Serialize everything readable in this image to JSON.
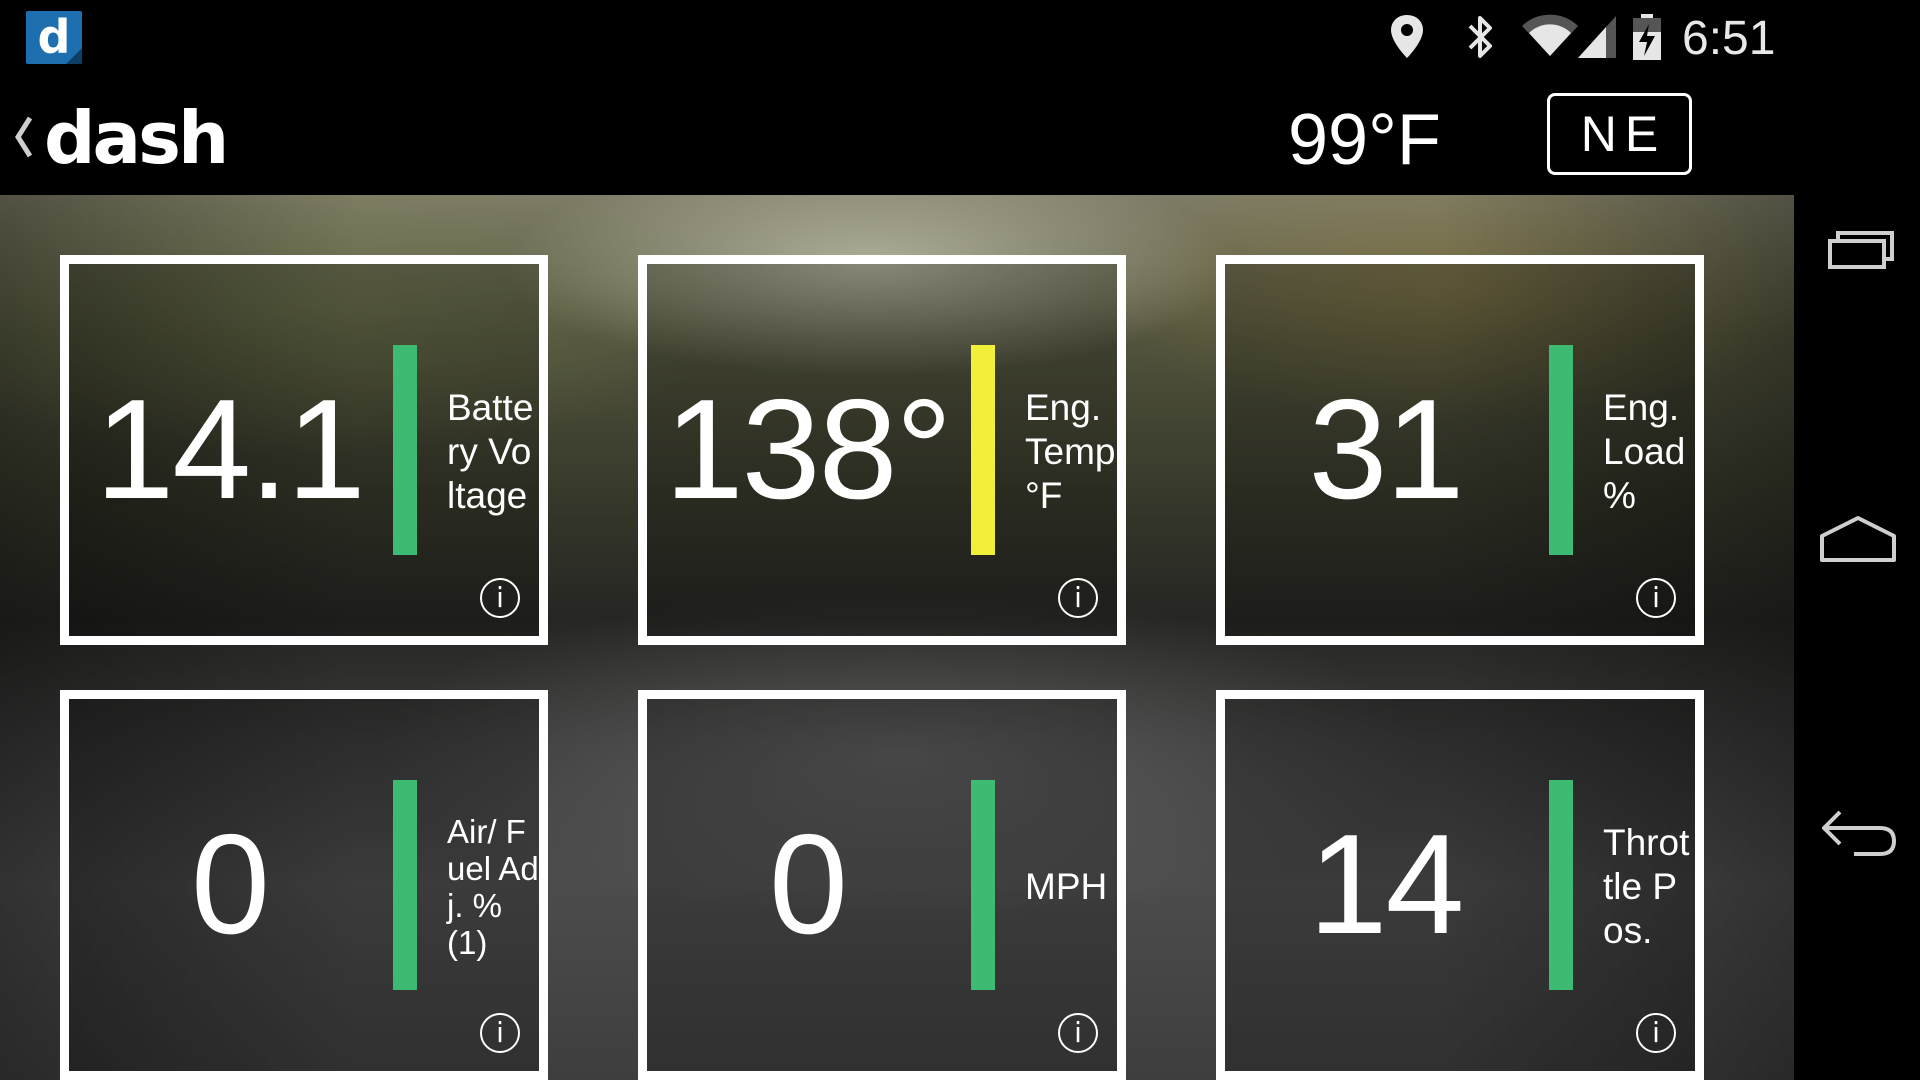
{
  "status_bar": {
    "notification_app_letter": "d",
    "icons": [
      "location-icon",
      "bluetooth-icon",
      "wifi-icon",
      "cell-signal-icon",
      "battery-charging-icon"
    ],
    "time": "6:51"
  },
  "action_bar": {
    "app_name": "dash",
    "temperature": "99°F",
    "compass_heading": "NE"
  },
  "tiles": [
    {
      "value": "14.1",
      "label": "Battery Voltage",
      "status_color": "#3dbb73",
      "info_glyph": "i"
    },
    {
      "value": "138°",
      "label": "Eng. Temp °F",
      "status_color": "#f2ef3b",
      "info_glyph": "i"
    },
    {
      "value": "31",
      "label": "Eng. Load %",
      "status_color": "#3dbb73",
      "info_glyph": "i"
    },
    {
      "value": "0",
      "label": "Air/ Fuel Adj. % (1)",
      "status_color": "#3dbb73",
      "info_glyph": "i"
    },
    {
      "value": "0",
      "label": "MPH",
      "status_color": "#3dbb73",
      "info_glyph": "i"
    },
    {
      "value": "14",
      "label": "Throttle Pos.",
      "status_color": "#3dbb73",
      "info_glyph": "i"
    }
  ],
  "nav_bar": {
    "buttons": [
      "recent-apps-icon",
      "home-icon",
      "back-icon"
    ]
  }
}
